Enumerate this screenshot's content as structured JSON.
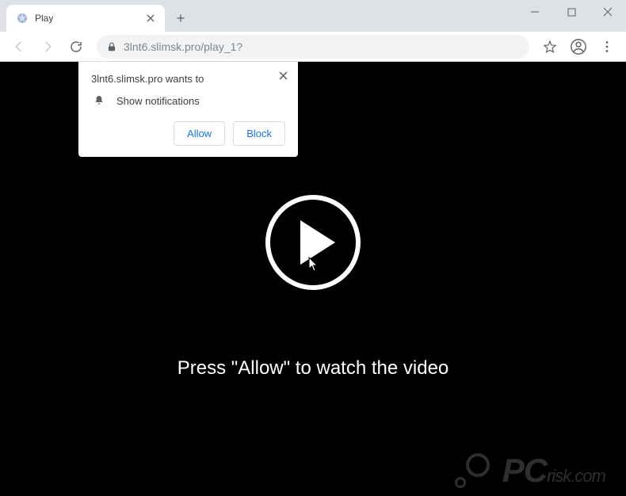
{
  "window": {
    "tab_title": "Play"
  },
  "toolbar": {
    "url": "3lnt6.slimsk.pro/play_1?"
  },
  "permission": {
    "title": "3lnt6.slimsk.pro wants to",
    "row_label": "Show notifications",
    "allow": "Allow",
    "block": "Block"
  },
  "page": {
    "message": "Press \"Allow\" to watch the video"
  },
  "watermark": {
    "brand_main": "PC",
    "brand_sub": "risk",
    "brand_tld": ".com"
  }
}
